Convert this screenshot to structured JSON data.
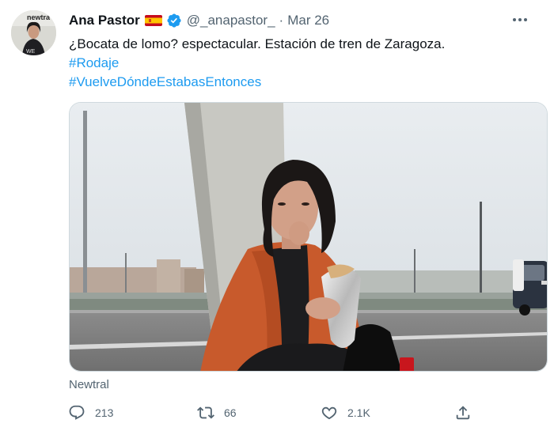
{
  "tweet": {
    "author": {
      "name": "Ana Pastor",
      "handle": "@_anapastor_",
      "flag_icon": "spain-flag-icon",
      "verified_icon": "verified-badge-icon"
    },
    "separator": "·",
    "date": "Mar 26",
    "text": "¿Bocata de lomo? espectacular. Estación de tren de Zaragoza.",
    "hashtags": [
      "#Rodaje",
      "#VuelveDóndeEstabasEntonces"
    ],
    "media": {
      "icon": "photo-woman-eating-sandwich-by-highway",
      "avatar_text": "newtra"
    },
    "source": "Newtral",
    "actions": {
      "replies": "213",
      "retweets": "66",
      "likes": "2.1K"
    }
  },
  "colors": {
    "accent": "#1d9bf0",
    "secondary_text": "#536471",
    "primary_text": "#0f1419"
  }
}
